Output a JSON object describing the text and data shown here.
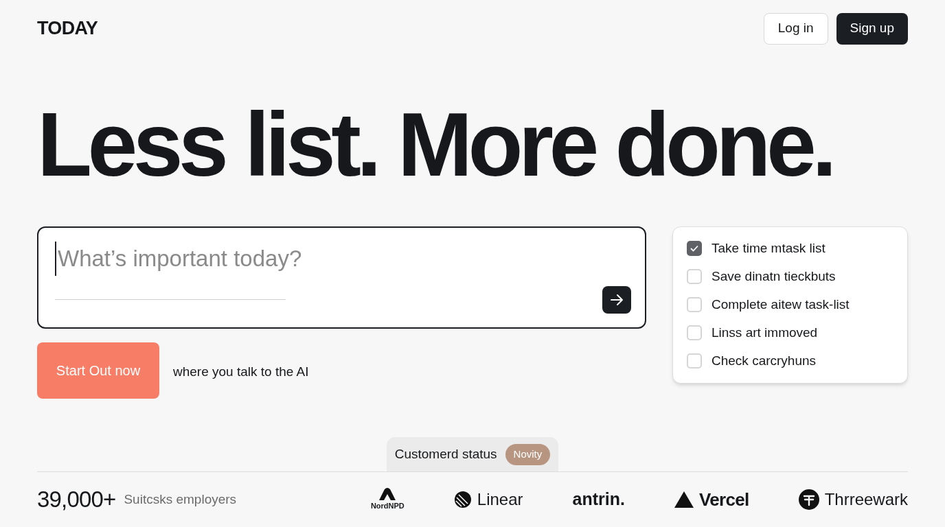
{
  "brand": "TODAY",
  "nav": [
    {
      "label": "Log in",
      "kind": "outline"
    },
    {
      "label": "Sign up",
      "kind": "solid"
    }
  ],
  "headline": "Less list. More done.",
  "task_input": {
    "placeholder": "What’s important today?"
  },
  "cta": {
    "label": "Start Out now",
    "caption": "where you talk to the AI"
  },
  "checklist": [
    {
      "label": "Take time mtask list",
      "checked": true
    },
    {
      "label": "Save dinatn tieckbuts",
      "checked": false
    },
    {
      "label": "Complete aitew task-list",
      "checked": false
    },
    {
      "label": "Linss art immoved",
      "checked": false
    },
    {
      "label": "Check carcryhuns",
      "checked": false
    }
  ],
  "status": {
    "label": "Customerd status",
    "badge": "Novity"
  },
  "stats": {
    "value": "39,000+",
    "label": "Suitcsks employers"
  },
  "logos": [
    {
      "name": "NordNPD",
      "kind": "arch"
    },
    {
      "name": "Linear",
      "kind": "circle"
    },
    {
      "name": "antrin.",
      "kind": "text"
    },
    {
      "name": "Vercel",
      "kind": "triangle"
    },
    {
      "name": "Thrreewark",
      "kind": "badge"
    }
  ]
}
